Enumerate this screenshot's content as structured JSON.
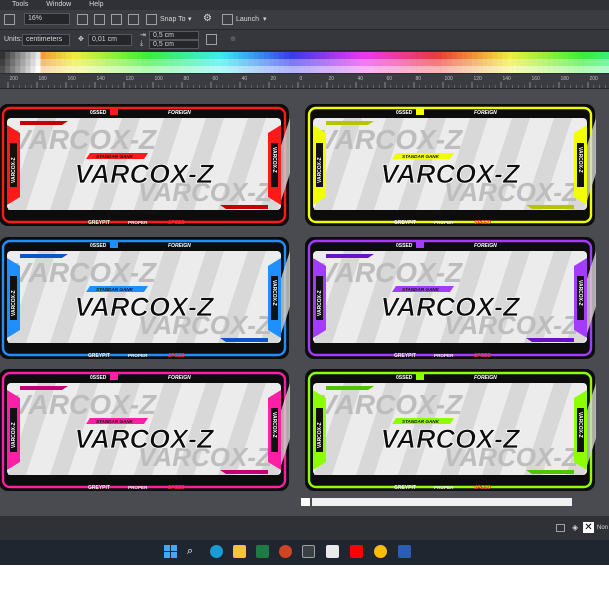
{
  "menu": {
    "tools": "Tools",
    "window": "Window",
    "help": "Help"
  },
  "toolbar": {
    "zoom": "16%",
    "snap_to": "Snap To",
    "launch": "Launch",
    "units_label": "Units:",
    "units_value": "centimeters",
    "nudge": "0,01 cm",
    "dup_x": "0,5 cm",
    "dup_y": "0,5 cm"
  },
  "ruler": {
    "ticks": [
      "200",
      "180",
      "160",
      "140",
      "120",
      "100",
      "80",
      "60",
      "40",
      "20",
      "0",
      "20",
      "40",
      "60",
      "80",
      "100",
      "120",
      "140",
      "160",
      "180",
      "200"
    ]
  },
  "plates": [
    {
      "id": "red",
      "accent": "#ff1a1a",
      "accent2": "#c40000"
    },
    {
      "id": "yellow",
      "accent": "#f2ff00",
      "accent2": "#b9c400"
    },
    {
      "id": "blue",
      "accent": "#1e8fff",
      "accent2": "#0b55c9"
    },
    {
      "id": "purple",
      "accent": "#a43cff",
      "accent2": "#6a12c8"
    },
    {
      "id": "pink",
      "accent": "#ff1ea6",
      "accent2": "#c40074"
    },
    {
      "id": "green",
      "accent": "#8cff00",
      "accent2": "#4fc400"
    }
  ],
  "plate_text": {
    "badge": "STANDAR GANK",
    "brand": "VARCOX-Z",
    "side": "VARCOX-Z",
    "tagline": "VVIP CONTEST PARKING ONLY",
    "sponsor1": "GREYPIT",
    "sponsor2": "PROPER",
    "sponsor3": "SPEED",
    "top_left": "0SSED",
    "top_right": "FOREIGN"
  },
  "status": {
    "label": "Non"
  },
  "colors": {
    "chrome": "#3a3c42",
    "canvas": "#4a4b50",
    "taskbar": "#1f2630"
  }
}
